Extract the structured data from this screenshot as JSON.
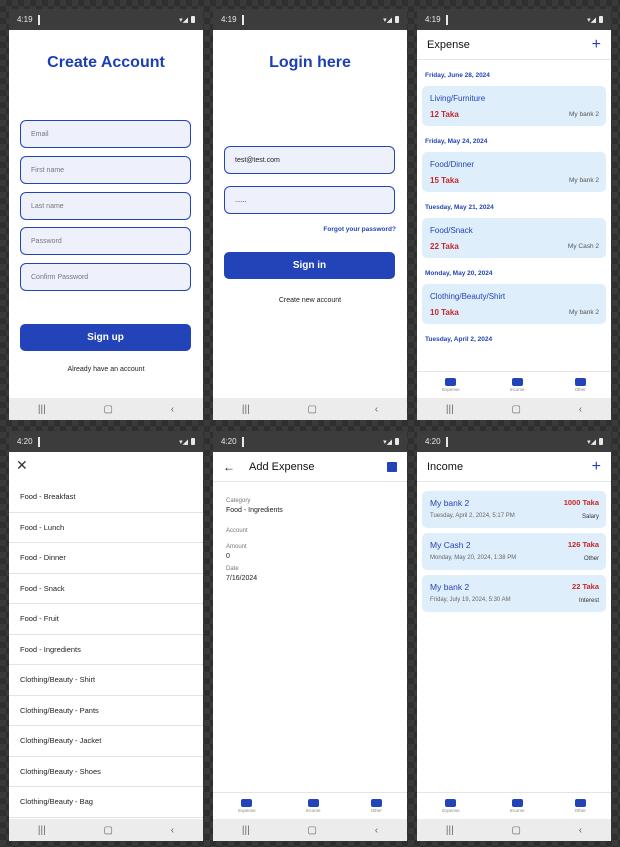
{
  "status_times": [
    "4:19",
    "4:19",
    "4:19",
    "4:20",
    "4:20",
    "4:20"
  ],
  "create": {
    "title": "Create Account",
    "placeholders": [
      "Email",
      "First name",
      "Last name",
      "Password",
      "Confirm Password"
    ],
    "button": "Sign up",
    "link": "Already have an account"
  },
  "login": {
    "title": "Login here",
    "email_value": "test@test.com",
    "password_value": "......",
    "forgot": "Forgot your password?",
    "button": "Sign in",
    "link": "Create new account"
  },
  "expense": {
    "title": "Expense",
    "groups": [
      {
        "date": "Friday, June 28, 2024",
        "category": "Living/Furniture",
        "amount": "12 Taka",
        "account": "My bank 2"
      },
      {
        "date": "Friday, May 24, 2024",
        "category": "Food/Dinner",
        "amount": "15 Taka",
        "account": "My bank 2"
      },
      {
        "date": "Tuesday, May 21, 2024",
        "category": "Food/Snack",
        "amount": "22 Taka",
        "account": "My Cash 2"
      },
      {
        "date": "Monday, May 20, 2024",
        "category": "Clothing/Beauty/Shirt",
        "amount": "10 Taka",
        "account": "My bank 2"
      }
    ],
    "last_date": "Tuesday, April 2, 2024"
  },
  "tabs": [
    "Expense",
    "Income",
    "Other"
  ],
  "categories": [
    "Food - Breakfast",
    "Food - Lunch",
    "Food - Dinner",
    "Food - Snack",
    "Food - Fruit",
    "Food - Ingredients",
    "Clothing/Beauty - Shirt",
    "Clothing/Beauty - Pants",
    "Clothing/Beauty - Jacket",
    "Clothing/Beauty - Shoes",
    "Clothing/Beauty - Bag"
  ],
  "add_expense": {
    "title": "Add Expense",
    "category_label": "Category",
    "category_value": "Food - Ingredients",
    "account_label": "Account",
    "amount_label": "Amount",
    "amount_value": "0",
    "date_label": "Date",
    "date_value": "7/16/2024"
  },
  "income": {
    "title": "Income",
    "items": [
      {
        "bank": "My bank 2",
        "date": "Tuesday, April 2, 2024, 5:17 PM",
        "amount": "1000 Taka",
        "source": "Salary"
      },
      {
        "bank": "My Cash 2",
        "date": "Monday, May 20, 2024, 1:38 PM",
        "amount": "126 Taka",
        "source": "Other"
      },
      {
        "bank": "My bank 2",
        "date": "Friday, July 19, 2024, 5:30 AM",
        "amount": "22 Taka",
        "source": "Interest"
      }
    ]
  },
  "colors": {
    "accent": "#2344b8",
    "card": "#dfeefb",
    "amount": "#c62828"
  }
}
